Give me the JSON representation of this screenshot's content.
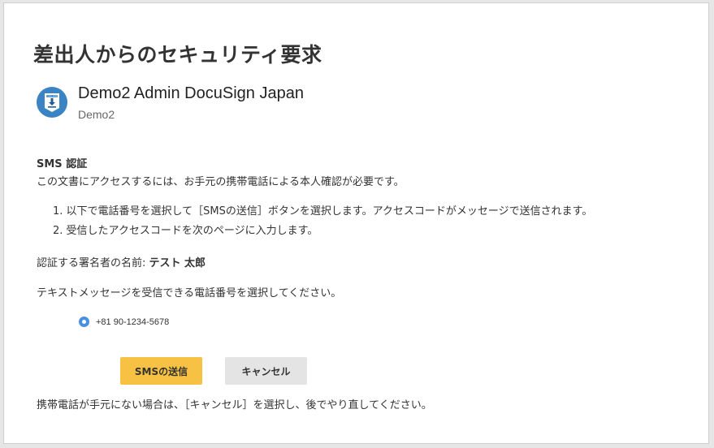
{
  "dialog": {
    "title": "差出人からのセキュリティ要求"
  },
  "sender": {
    "avatar_icon": "download-document-icon",
    "avatar_text": "CODE HERE",
    "name": "Demo2 Admin DocuSign Japan",
    "company": "Demo2"
  },
  "sms": {
    "heading": "SMS 認証",
    "intro": "この文書にアクセスするには、お手元の携帯電話による本人確認が必要です。",
    "steps": [
      "1. 以下で電話番号を選択して［SMSの送信］ボタンを選択します。アクセスコードがメッセージで送信されます。",
      "2. 受信したアクセスコードを次のページに入力します。"
    ],
    "signer_label": "認証する署名者の名前: ",
    "signer_name": "テスト 太郎",
    "choose_phone": "テキストメッセージを受信できる電話番号を選択してください。",
    "phone_number": "+81 90-1234-5678",
    "phone_selected": true
  },
  "buttons": {
    "send_label": "SMSの送信",
    "cancel_label": "キャンセル"
  },
  "footer_note": "携帯電話が手元にない場合は、［キャンセル］を選択し、後でやり直してください。",
  "colors": {
    "send_button": "#f7c244",
    "cancel_button": "#e4e4e4",
    "radio_selected": "#4a90e2",
    "avatar_bg": "#3b84c4"
  }
}
